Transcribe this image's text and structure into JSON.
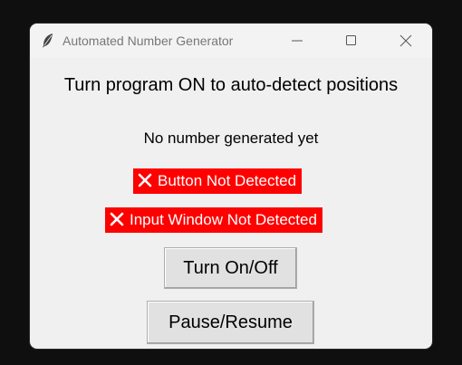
{
  "window": {
    "title": "Automated Number Generator",
    "icon": "feather-icon"
  },
  "titlebar_controls": {
    "minimize_icon": "minimize-icon",
    "maximize_icon": "maximize-icon",
    "close_icon": "close-icon"
  },
  "main": {
    "heading": "Turn program ON to auto-detect positions",
    "status": "No number generated yet",
    "badges": [
      {
        "label": "Button Not Detected",
        "icon": "x-icon",
        "color": "#ff0000"
      },
      {
        "label": "Input Window Not Detected",
        "icon": "x-icon",
        "color": "#ff0000"
      }
    ],
    "buttons": {
      "toggle_label": "Turn On/Off",
      "pause_label": "Pause/Resume"
    }
  }
}
